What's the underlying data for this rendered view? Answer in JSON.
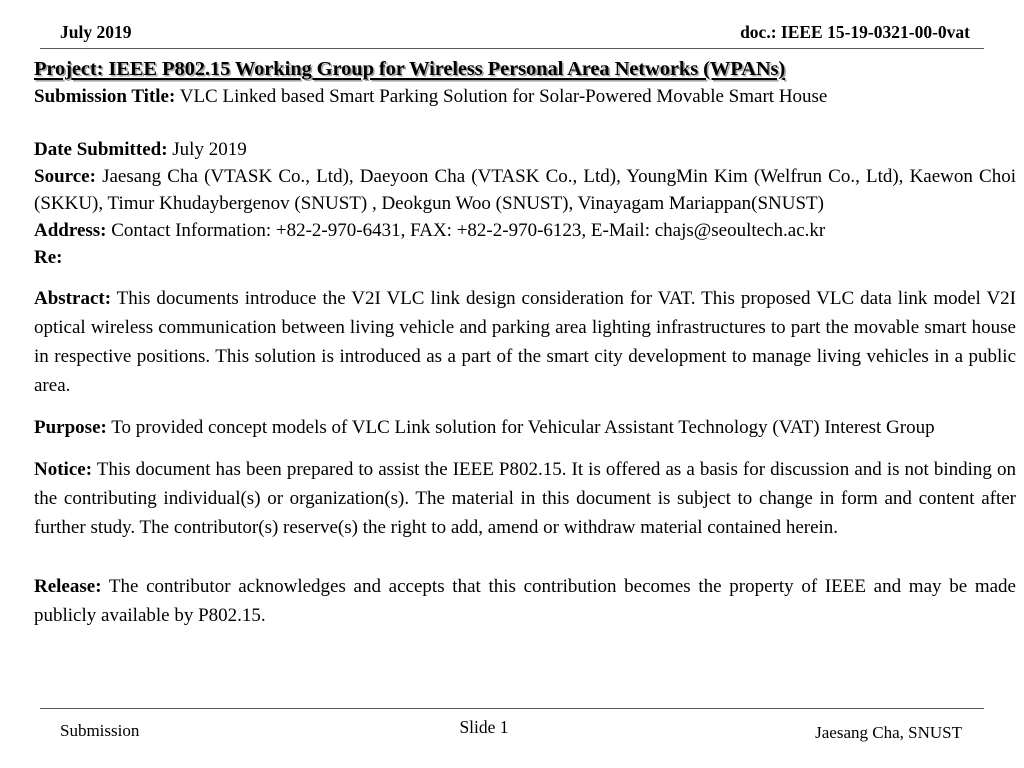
{
  "header": {
    "date": "July 2019",
    "doc_number": "doc.: IEEE 15-19-0321-00-0vat"
  },
  "slide": {
    "project_line": "Project: IEEE P802.15 Working Group for Wireless Personal Area Networks (WPANs)",
    "submission_title_lead": "Submission Title:",
    "submission_title_text": " VLC Linked based Smart Parking Solution for Solar-Powered Movable Smart House",
    "date_submitted_lead": "Date Submitted:",
    "date_submitted_text": " July 2019",
    "source_lead": "Source:",
    "source_text": " Jaesang Cha (VTASK Co., Ltd), Daeyoon Cha (VTASK Co., Ltd), YoungMin Kim (Welfrun Co., Ltd), Kaewon Choi (SKKU), Timur Khudaybergenov (SNUST) , Deokgun Woo (SNUST), Vinayagam Mariappan(SNUST)",
    "address_lead": "Address:",
    "address_text": " Contact Information: +82-2-970-6431, FAX: +82-2-970-6123, E-Mail: chajs@seoultech.ac.kr",
    "re_lead": "Re:",
    "re_text": "",
    "abstract_lead": "Abstract:",
    "abstract_text": " This documents introduce the V2I  VLC link design consideration for VAT. This proposed VLC data link model V2I optical wireless communication between living vehicle and parking area lighting infrastructures to part the movable smart house in respective positions. This solution is introduced as a part of the smart city development to manage living vehicles in a public area.",
    "purpose_lead": "Purpose:",
    "purpose_text": " To provided concept models of  VLC Link solution for Vehicular Assistant Technology (VAT) Interest Group",
    "notice_lead": "Notice:",
    "notice_text": " This document has been prepared to assist the IEEE P802.15.  It is offered as a basis for discussion and is not binding on the contributing individual(s) or organization(s). The material in this document is subject to change in form and content after further study. The contributor(s) reserve(s) the right to add, amend or withdraw material contained herein.",
    "release_lead": "Release:",
    "release_text": " The contributor acknowledges and accepts that this contribution becomes the property of IEEE and may be made publicly available by P802.15."
  },
  "footer": {
    "left": "Submission",
    "center": "Slide 1",
    "right": "Jaesang Cha, SNUST"
  },
  "colors": {
    "text": "#000000",
    "rule": "#5a5a5a",
    "title_shadow": "#969696",
    "background": "#ffffff"
  }
}
